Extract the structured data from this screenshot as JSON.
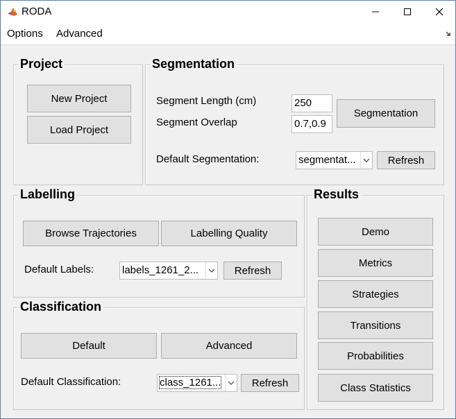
{
  "window": {
    "title": "RODA"
  },
  "menu": {
    "options": "Options",
    "advanced": "Advanced"
  },
  "project": {
    "title": "Project",
    "new_project": "New Project",
    "load_project": "Load Project"
  },
  "segmentation": {
    "title": "Segmentation",
    "length_label": "Segment Length (cm)",
    "length_value": "250",
    "overlap_label": "Segment Overlap",
    "overlap_value": "0.7,0.9",
    "segmentation_button": "Segmentation",
    "default_label": "Default Segmentation:",
    "default_value": "segmentat...",
    "refresh": "Refresh"
  },
  "labelling": {
    "title": "Labelling",
    "browse": "Browse Trajectories",
    "quality": "Labelling Quality",
    "default_label": "Default Labels:",
    "default_value": "labels_1261_2...",
    "refresh": "Refresh"
  },
  "classification": {
    "title": "Classification",
    "default_button": "Default",
    "advanced_button": "Advanced",
    "default_label": "Default Classification:",
    "default_value": "class_1261...",
    "refresh": "Refresh"
  },
  "results": {
    "title": "Results",
    "buttons": [
      "Demo",
      "Metrics",
      "Strategies",
      "Transitions",
      "Probabilities",
      "Class Statistics"
    ]
  },
  "icons": {
    "app": "matlab-icon",
    "minimize": "minimize-icon",
    "maximize": "maximize-icon",
    "close": "close-icon",
    "dropdown": "chevron-down-icon",
    "dock": "dock-arrow-icon"
  },
  "colors": {
    "panel_bg": "#f0f0f0",
    "button_bg": "#e1e1e1",
    "button_border": "#adadad"
  }
}
